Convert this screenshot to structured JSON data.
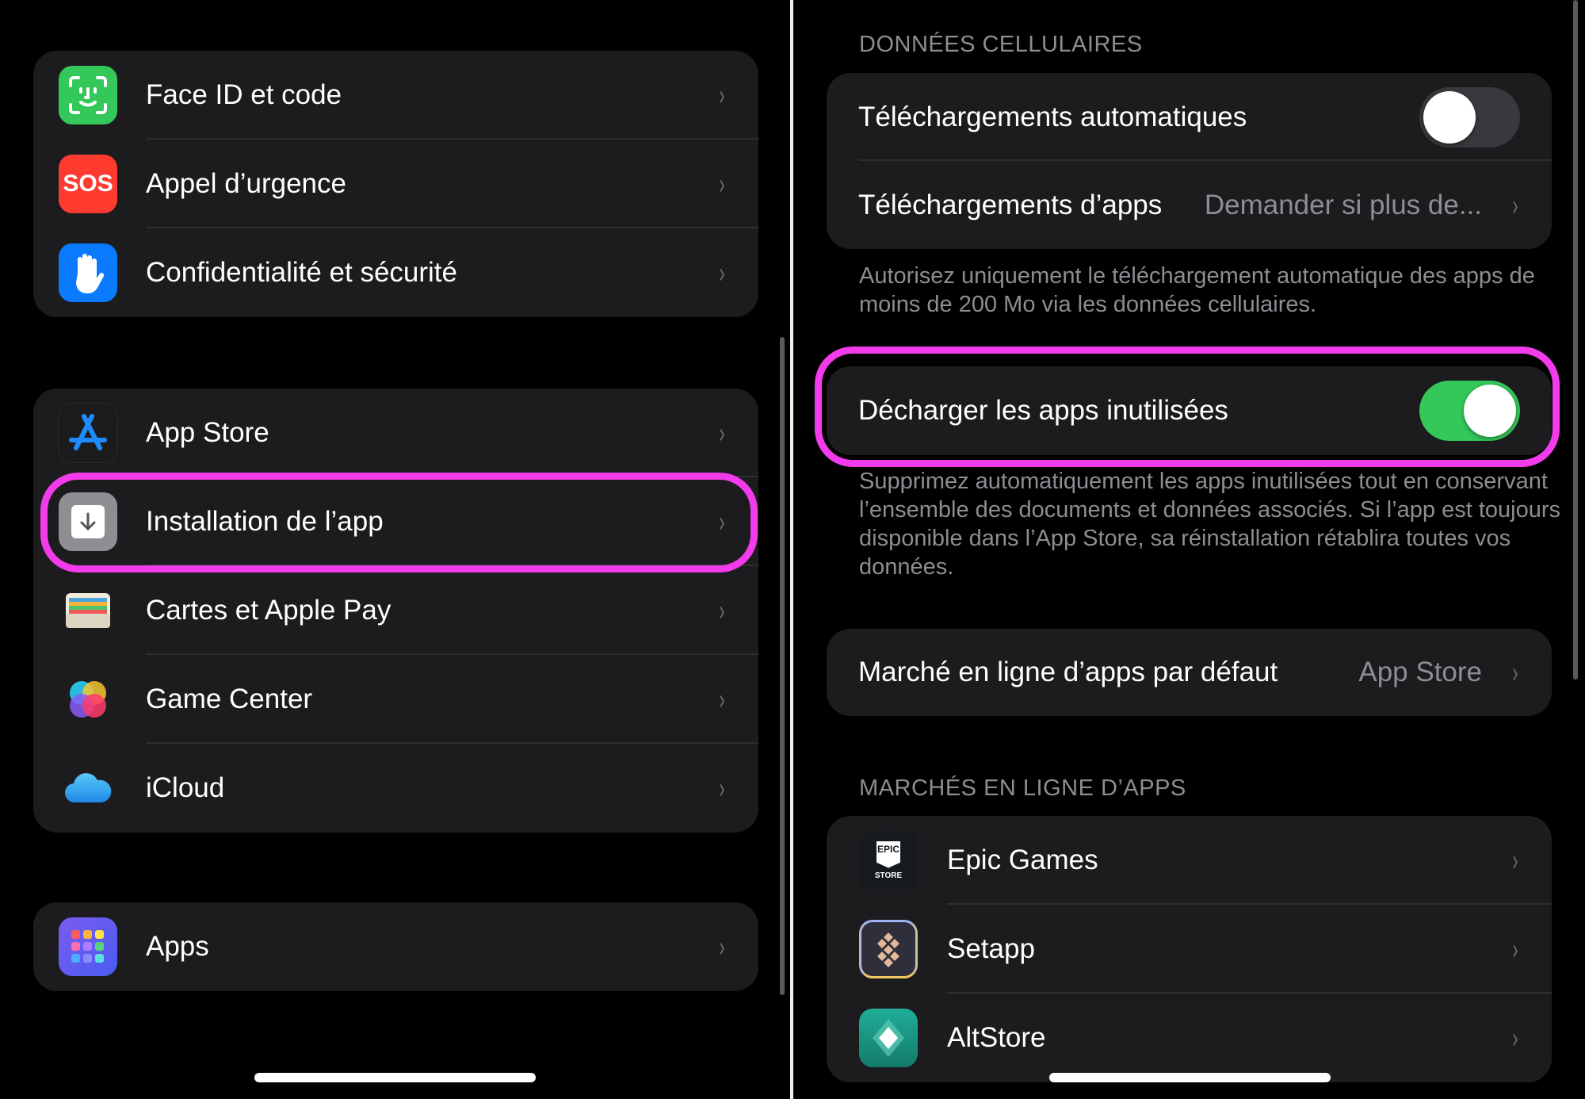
{
  "left_panel": {
    "group1": [
      {
        "label": "Face ID et code",
        "icon": "face-id-icon",
        "color": "#34c759"
      },
      {
        "label": "Appel d’urgence",
        "icon": "sos-icon",
        "color": "#ff3b30",
        "icon_text": "SOS"
      },
      {
        "label": "Confidentialité et sécurité",
        "icon": "hand-icon",
        "color": "#0a7aff"
      }
    ],
    "group2": [
      {
        "label": "App Store",
        "icon": "app-store-icon",
        "color": "#1c1c1e"
      },
      {
        "label": "Installation de l’app",
        "icon": "download-icon",
        "color": "#8e8e93"
      },
      {
        "label": "Cartes et Apple Pay",
        "icon": "wallet-icon",
        "color": "#1c1c1e"
      },
      {
        "label": "Game Center",
        "icon": "game-center-icon",
        "color": "#1c1c1e"
      },
      {
        "label": "iCloud",
        "icon": "icloud-icon",
        "color": "#1c1c1e"
      }
    ],
    "group3": [
      {
        "label": "Apps",
        "icon": "apps-grid-icon",
        "color": "#5e5ce6"
      }
    ],
    "highlight_color": "#f23bea"
  },
  "right_panel": {
    "cellular_header": "DONNÉES CELLULAIRES",
    "auto_downloads": {
      "label": "Téléchargements automatiques",
      "on": false
    },
    "app_downloads": {
      "label": "Téléchargements d’apps",
      "value": "Demander si plus de..."
    },
    "cellular_footer": "Autorisez uniquement le téléchargement automatique des apps de moins de 200 Mo via les données cellulaires.",
    "offload": {
      "label": "Décharger les apps inutilisées",
      "on": true,
      "on_color": "#34c759"
    },
    "offload_footer": "Supprimez automatiquement les apps inutilisées tout en conservant l’ensemble des documents et données associés. Si l’app est toujours disponible dans l’App Store, sa réinstallation rétablira toutes vos données.",
    "default_market": {
      "label": "Marché en ligne d’apps par défaut",
      "value": "App Store"
    },
    "markets_header": "MARCHÉS EN LIGNE D’APPS",
    "markets": [
      {
        "label": "Epic Games",
        "icon": "epic-games-icon",
        "icon_text": "EPIC",
        "icon_subtext": "STORE"
      },
      {
        "label": "Setapp",
        "icon": "setapp-icon"
      },
      {
        "label": "AltStore",
        "icon": "altstore-icon"
      }
    ]
  },
  "chevron": "›"
}
